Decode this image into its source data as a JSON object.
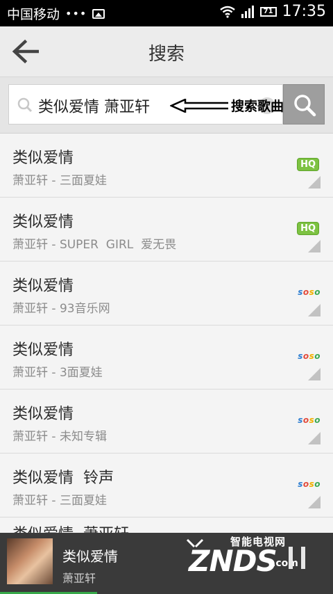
{
  "status_bar": {
    "carrier": "中国移动",
    "dots": "•••",
    "battery": "71",
    "time": "17:35"
  },
  "header": {
    "title": "搜索",
    "back_icon": "back-arrow-icon"
  },
  "search": {
    "query": "类似爱情 萧亚轩",
    "annotation": "搜索歌曲",
    "search_icon": "search-icon"
  },
  "results": [
    {
      "title": "类似爱情",
      "subtitle": "萧亚轩 - 三面夏娃",
      "badge": "HQ"
    },
    {
      "title": "类似爱情",
      "subtitle": "萧亚轩 - SUPER  GIRL  爱无畏",
      "badge": "HQ"
    },
    {
      "title": "类似爱情",
      "subtitle": "萧亚轩 - 93音乐网",
      "badge": "soso"
    },
    {
      "title": "类似爱情",
      "subtitle": "萧亚轩 - 3面夏娃",
      "badge": "soso"
    },
    {
      "title": "类似爱情",
      "subtitle": "萧亚轩 - 未知专辑",
      "badge": "soso"
    },
    {
      "title": "类似爱情  铃声",
      "subtitle": "萧亚轩 - 三面夏娃",
      "badge": "soso"
    }
  ],
  "partial_row_title": "类似爱情  萧亚轩",
  "player": {
    "title": "类似爱情",
    "artist": "萧亚轩"
  },
  "watermark": {
    "site": "ZNDS",
    "tagline": "智能电视网",
    "suffix": ".com"
  },
  "colors": {
    "hq_green": "#7dc242",
    "progress_green": "#37a94a",
    "status_bar": "#000000"
  }
}
